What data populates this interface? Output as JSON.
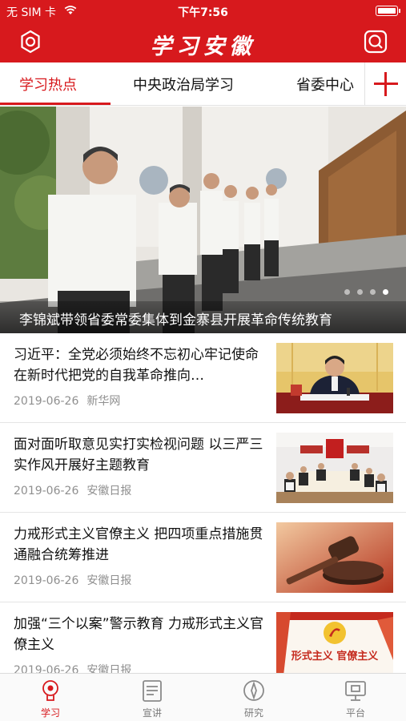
{
  "status_bar": {
    "carrier": "无 SIM 卡",
    "time": "下午7:56"
  },
  "header": {
    "title": "学习安徽",
    "settings_icon": "gear-icon",
    "search_icon": "search-icon"
  },
  "tabs": [
    {
      "label": "学习热点",
      "active": true
    },
    {
      "label": "中央政治局学习",
      "active": false
    },
    {
      "label": "省委中心",
      "active": false
    }
  ],
  "tab_add_icon": "plus-icon",
  "banner": {
    "caption": "李锦斌带领省委常委集体到金寨县开展革命传统教育",
    "dots": 4,
    "active_dot": 3
  },
  "news": [
    {
      "title": "习近平：全党必须始终不忘初心牢记使命 在新时代把党的自我革命推向…",
      "date": "2019-06-26",
      "source": "新华网"
    },
    {
      "title": "面对面听取意见实打实检视问题 以三严三实作风开展好主题教育",
      "date": "2019-06-26",
      "source": "安徽日报"
    },
    {
      "title": "力戒形式主义官僚主义 把四项重点措施贯通融合统筹推进",
      "date": "2019-06-26",
      "source": "安徽日报"
    },
    {
      "title": "加强“三个以案”警示教育 力戒形式主义官僚主义",
      "date": "2019-06-26",
      "source": "安徽日报",
      "thumb_text": "形式主义 官僚主义"
    }
  ],
  "tabbar": [
    {
      "label": "学习",
      "icon": "study-icon",
      "active": true
    },
    {
      "label": "宣讲",
      "icon": "document-icon",
      "active": false
    },
    {
      "label": "研究",
      "icon": "compass-icon",
      "active": false
    },
    {
      "label": "平台",
      "icon": "monitor-icon",
      "active": false
    }
  ],
  "colors": {
    "brand_red": "#d7191d",
    "meta_gray": "#8f8f8f"
  }
}
